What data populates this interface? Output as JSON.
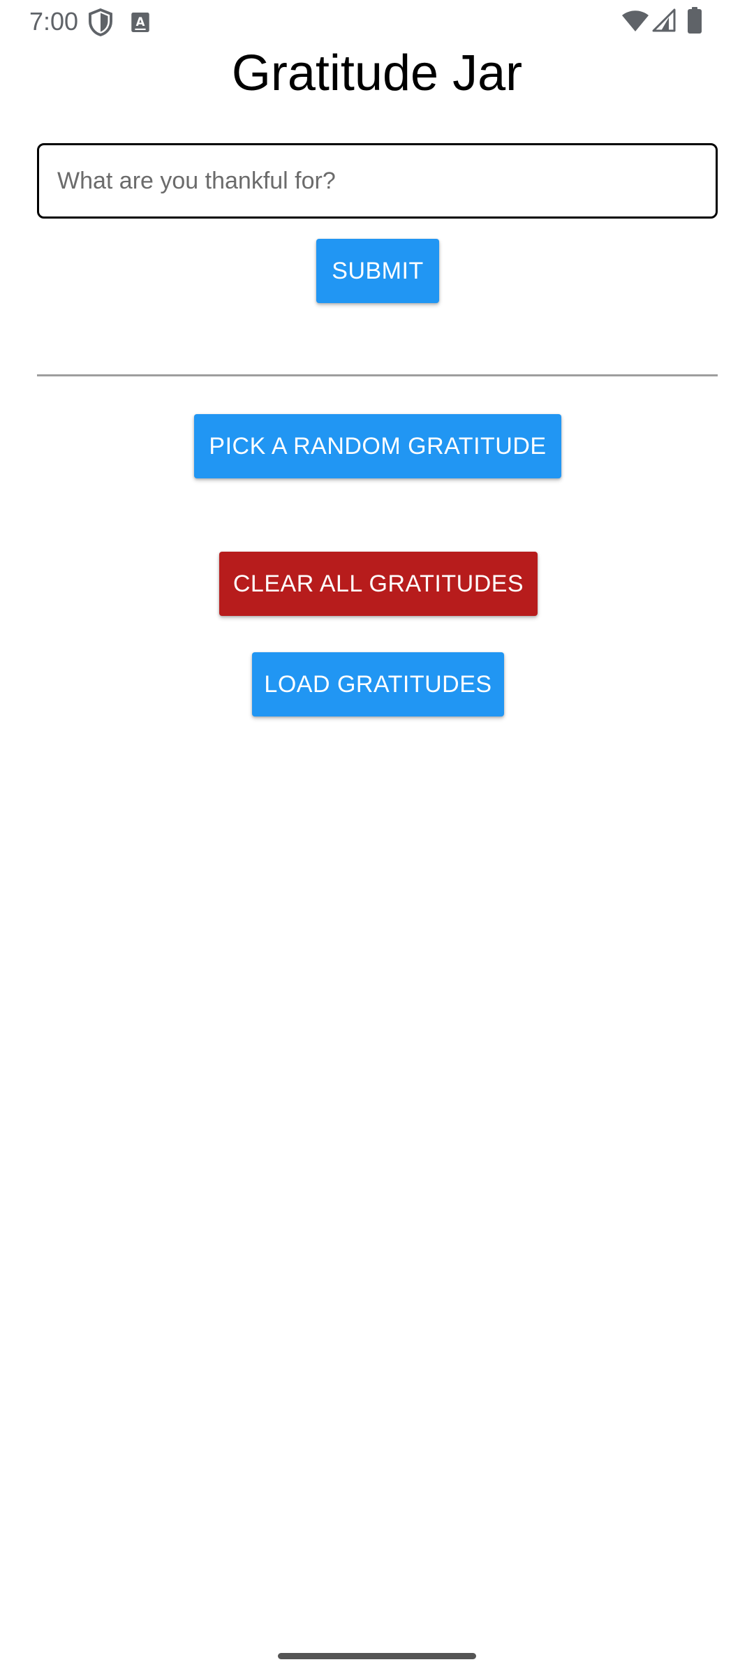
{
  "status_bar": {
    "time": "7:00",
    "icons": [
      "shield-icon",
      "keyboard-a-icon",
      "wifi-icon",
      "signal-icon",
      "battery-icon"
    ]
  },
  "header": {
    "title": "Gratitude Jar"
  },
  "form": {
    "input_placeholder": "What are you thankful for?",
    "input_value": "",
    "submit_label": "SUBMIT"
  },
  "actions": {
    "random_label": "PICK A RANDOM GRATITUDE",
    "clear_label": "CLEAR ALL GRATITUDES",
    "load_label": "LOAD GRATITUDES"
  },
  "colors": {
    "primary": "#2196f3",
    "danger": "#b71c1c",
    "divider": "#9e9e9e"
  }
}
